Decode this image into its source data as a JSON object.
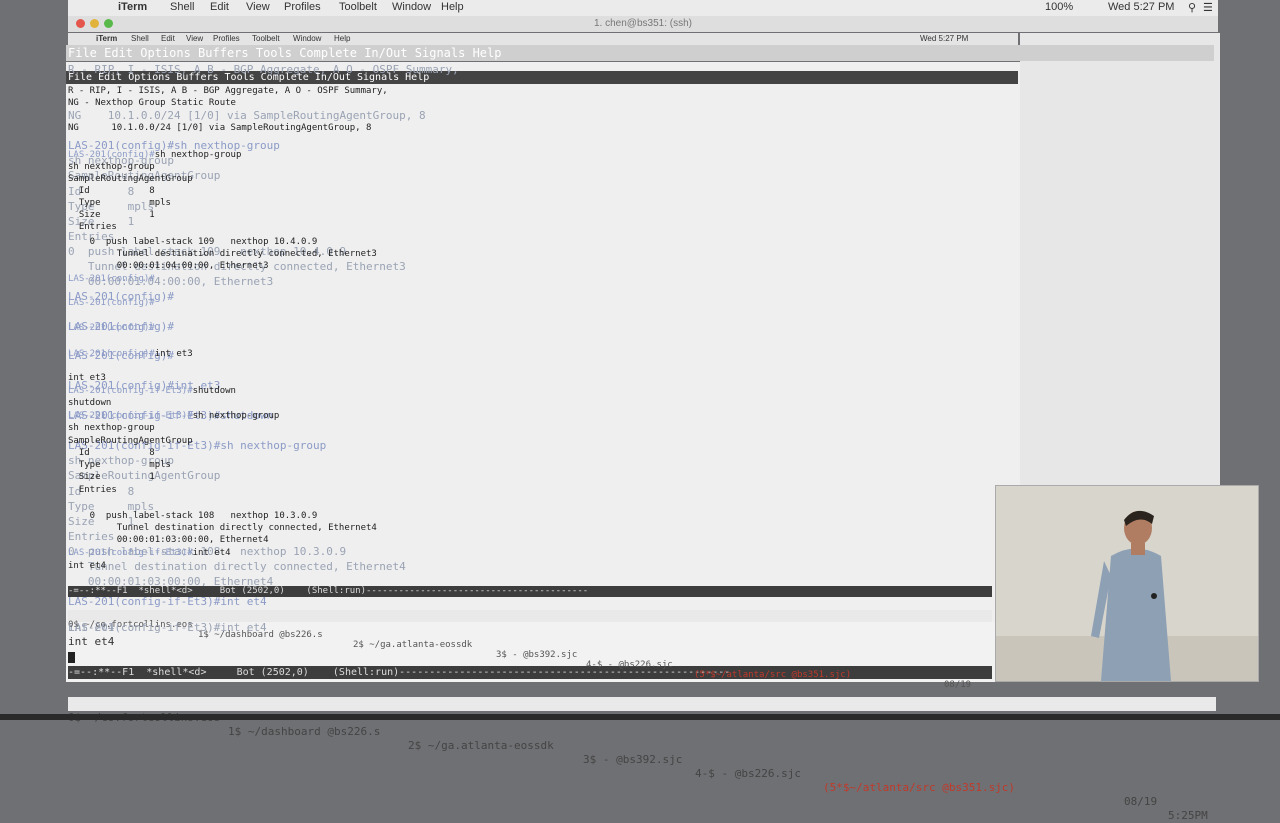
{
  "macMenu": {
    "items": [
      "iTerm",
      "Shell",
      "Edit",
      "View",
      "Profiles",
      "Toolbelt",
      "Window",
      "Help"
    ],
    "clock": "Wed 5:27 PM",
    "battery": "100%"
  },
  "windowTitle": "1. chen@bs351: (ssh)",
  "innerMenu": {
    "items": [
      "iTerm",
      "Shell",
      "Edit",
      "View",
      "Profiles",
      "Toolbelt",
      "Window",
      "Help"
    ],
    "clock": "Wed 5:27 PM"
  },
  "emacsMenuOuter": "File Edit Options Buffers Tools Complete In/Out Signals Help",
  "emacsMenuInner": "File Edit Options Buffers Tools Complete In/Out Signals Help",
  "terminal": {
    "ghostLines": [
      "R - RIP, I - ISIS, A B - BGP Aggregate, A O - OSPF Summary,",
      "NG    10.1.0.0/24 [1/0] via SampleRoutingAgentGroup, 8",
      "LAS-201(config)#sh nexthop-group",
      "sh nexthop-group",
      "SampleRoutingAgentGroup",
      "Id       8",
      "Type     mpls",
      "Size     1",
      "Entries",
      "0  push label-stack 109   nexthop 10.4.0.9",
      "   Tunnel destination directly connected, Ethernet3",
      "   00:00:01:04:00:00, Ethernet3",
      "LAS-201(config)#",
      "LAS-201(config)#",
      "LAS-201(config)#",
      "LAS-201(config)#int et3",
      "LAS-201(config-if-Et3)#shutdown",
      "LAS-201(config-if-Et3)#sh nexthop-group",
      "sh nexthop-group",
      "SampleRoutingAgentGroup",
      "Id       8",
      "Type     mpls",
      "Size     1",
      "Entries",
      "0  push label-stack 108   nexthop 10.3.0.9",
      "   Tunnel destination directly connected, Ethernet4",
      "   00:00:01:03:00:00, Ethernet4",
      "LAS-201(config-if-Et3)#int et4",
      "int et4"
    ],
    "lines": [
      "R - RIP, I - ISIS, A B - BGP Aggregate, A O - OSPF Summary,",
      "NG - Nexthop Group Static Route",
      "NG      10.1.0.0/24 [1/0] via SampleRoutingAgentGroup, 8",
      "LAS-201(config)#sh nexthop-group",
      "sh nexthop-group",
      "SampleRoutingAgentGroup",
      "  Id           8",
      "  Type         mpls",
      "  Size         1",
      "  Entries",
      "    0  push label-stack 109   nexthop 10.4.0.9",
      "         Tunnel destination directly connected, Ethernet3",
      "         00:00:01:04:00:00, Ethernet3",
      "LAS-201(config)#",
      "LAS-201(config)#",
      "LAS-201(config)#",
      "LAS-201(config)#int et3",
      "int et3",
      "LAS-201(config-if-Et3)#shutdown",
      "shutdown",
      "LAS-201(config-if-Et3)#sh nexthop-group",
      "sh nexthop-group",
      "SampleRoutingAgentGroup",
      "  Id           8",
      "  Type         mpls",
      "  Size         1",
      "  Entries",
      "    0  push label-stack 108   nexthop 10.3.0.9",
      "         Tunnel destination directly connected, Ethernet4",
      "         00:00:01:03:00:00, Ethernet4",
      "LAS-201(config-if-Et3)#int et4",
      "int et4"
    ]
  },
  "modeline": "-=--:**--F1  *shell*<d>     Bot (2502,0)    (Shell:run)-------------------------------------------------------",
  "modelineInner": "-=--:**--F1  *shell*<d>     Bot (2502,0)    (Shell:run)-----------------------------------------",
  "tabs": [
    "0$ ~/co.fortcollins.eos",
    "1$ ~/dashboard @bs226.s",
    "2$ ~/ga.atlanta-eossdk",
    "3$ - @bs392.sjc",
    "4-$ - @bs226.sjc",
    "(5*$~/atlanta/src @bs351.sjc)"
  ],
  "tabsRight": "08/19",
  "tabsClock": "5:25PM",
  "tabsRightInner": "08/19",
  "bottomPromptLine": "LAS-201(config-if-Et3)#int et4",
  "bottomEcho": "int et4",
  "colors": {
    "prompt": "#8c9bc7",
    "tabActive": "#c0392b",
    "modeline": "#3d3d3d"
  }
}
